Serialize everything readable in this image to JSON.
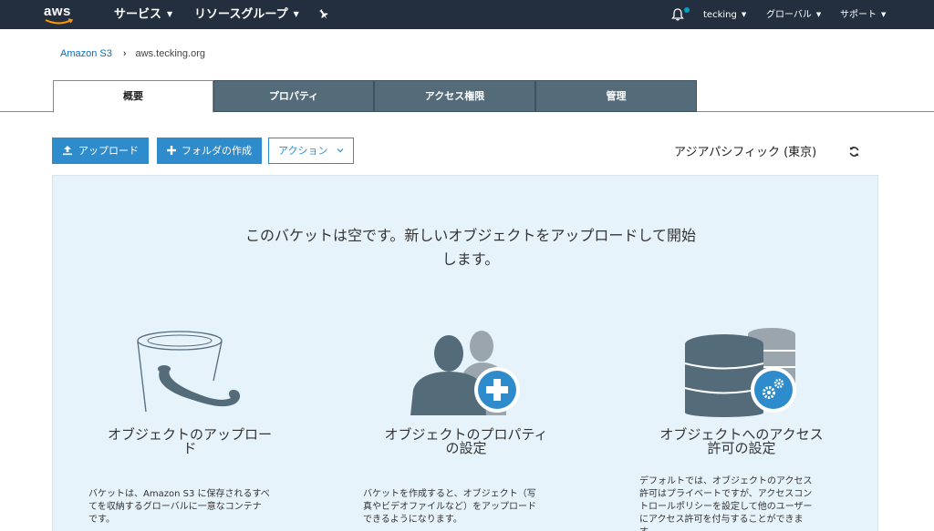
{
  "nav": {
    "logo": "aws",
    "services": "サービス",
    "resource_groups": "リソースグループ",
    "user": "tecking",
    "region": "グローバル",
    "support": "サポート"
  },
  "breadcrumb": {
    "root": "Amazon S3",
    "current": "aws.tecking.org"
  },
  "tabs": [
    {
      "label": "概要",
      "active": true
    },
    {
      "label": "プロパティ",
      "active": false
    },
    {
      "label": "アクセス権限",
      "active": false
    },
    {
      "label": "管理",
      "active": false
    }
  ],
  "actions": {
    "upload": "アップロード",
    "create_folder": "フォルダの作成",
    "actions": "アクション"
  },
  "region_label": "アジアパシフィック (東京)",
  "empty": {
    "headline_line1": "このバケットは空です。新しいオブジェクトをアップロードして開始",
    "headline_line2": "します。",
    "features": [
      {
        "icon": "bucket-icon",
        "title_line1": "オブジェクトのアップロー",
        "title_line2": "ド",
        "desc_lines": [
          "バケットは、Amazon S3 に保存されるすべ",
          "てを収納するグローバルに一意なコンテナ",
          "です。"
        ]
      },
      {
        "icon": "user-add-icon",
        "title_line1": "オブジェクトのプロパティ",
        "title_line2": "の設定",
        "desc_lines": [
          "バケットを作成すると、オブジェクト（写",
          "真やビデオファイルなど）をアップロード",
          "できるようになります。"
        ]
      },
      {
        "icon": "database-gear-icon",
        "title_line1": "オブジェクトへのアクセス",
        "title_line2": "許可の設定",
        "desc_lines": [
          "デフォルトでは、オブジェクトのアクセス",
          "許可はプライベートですが、アクセスコン",
          "トロールポリシーを設定して他のユーザー",
          "にアクセス許可を付与することができま",
          "す。"
        ]
      }
    ]
  },
  "colors": {
    "nav_bg": "#232f3e",
    "tab_bg": "#546b7a",
    "primary": "#2f8ccc",
    "panel_bg": "#e7f3fb",
    "icon_dark": "#546b7a",
    "icon_accent": "#2f8ccc"
  }
}
